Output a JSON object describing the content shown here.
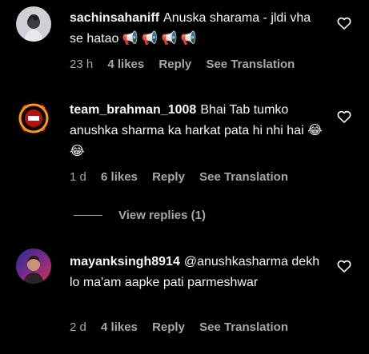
{
  "comments": [
    {
      "username": "sachinsahaniff",
      "text": "Anuska sharama - jldi vha se hatao 📢 📢 📢 📢",
      "time": "23 h",
      "likes": "4 likes",
      "reply": "Reply",
      "translate": "See Translation"
    },
    {
      "username": "team_brahman_1008",
      "text": "Bhai Tab tumko anushka sharma ka harkat pata hi nhi hai 😂 😂",
      "time": "1 d",
      "likes": "6 likes",
      "reply": "Reply",
      "translate": "See Translation"
    },
    {
      "username": "mayanksingh8914",
      "text": "@anushkasharma dekh lo ma'am aapke pati parmeshwar",
      "time": "2 d",
      "likes": "4 likes",
      "reply": "Reply",
      "translate": "See Translation"
    }
  ],
  "view_replies": "View replies (1)",
  "icons": {
    "like": "heart-outline-icon"
  },
  "colors": {
    "background": "#000000",
    "primary_text": "#f5f5f5",
    "secondary_text": "#a8a8a8"
  }
}
